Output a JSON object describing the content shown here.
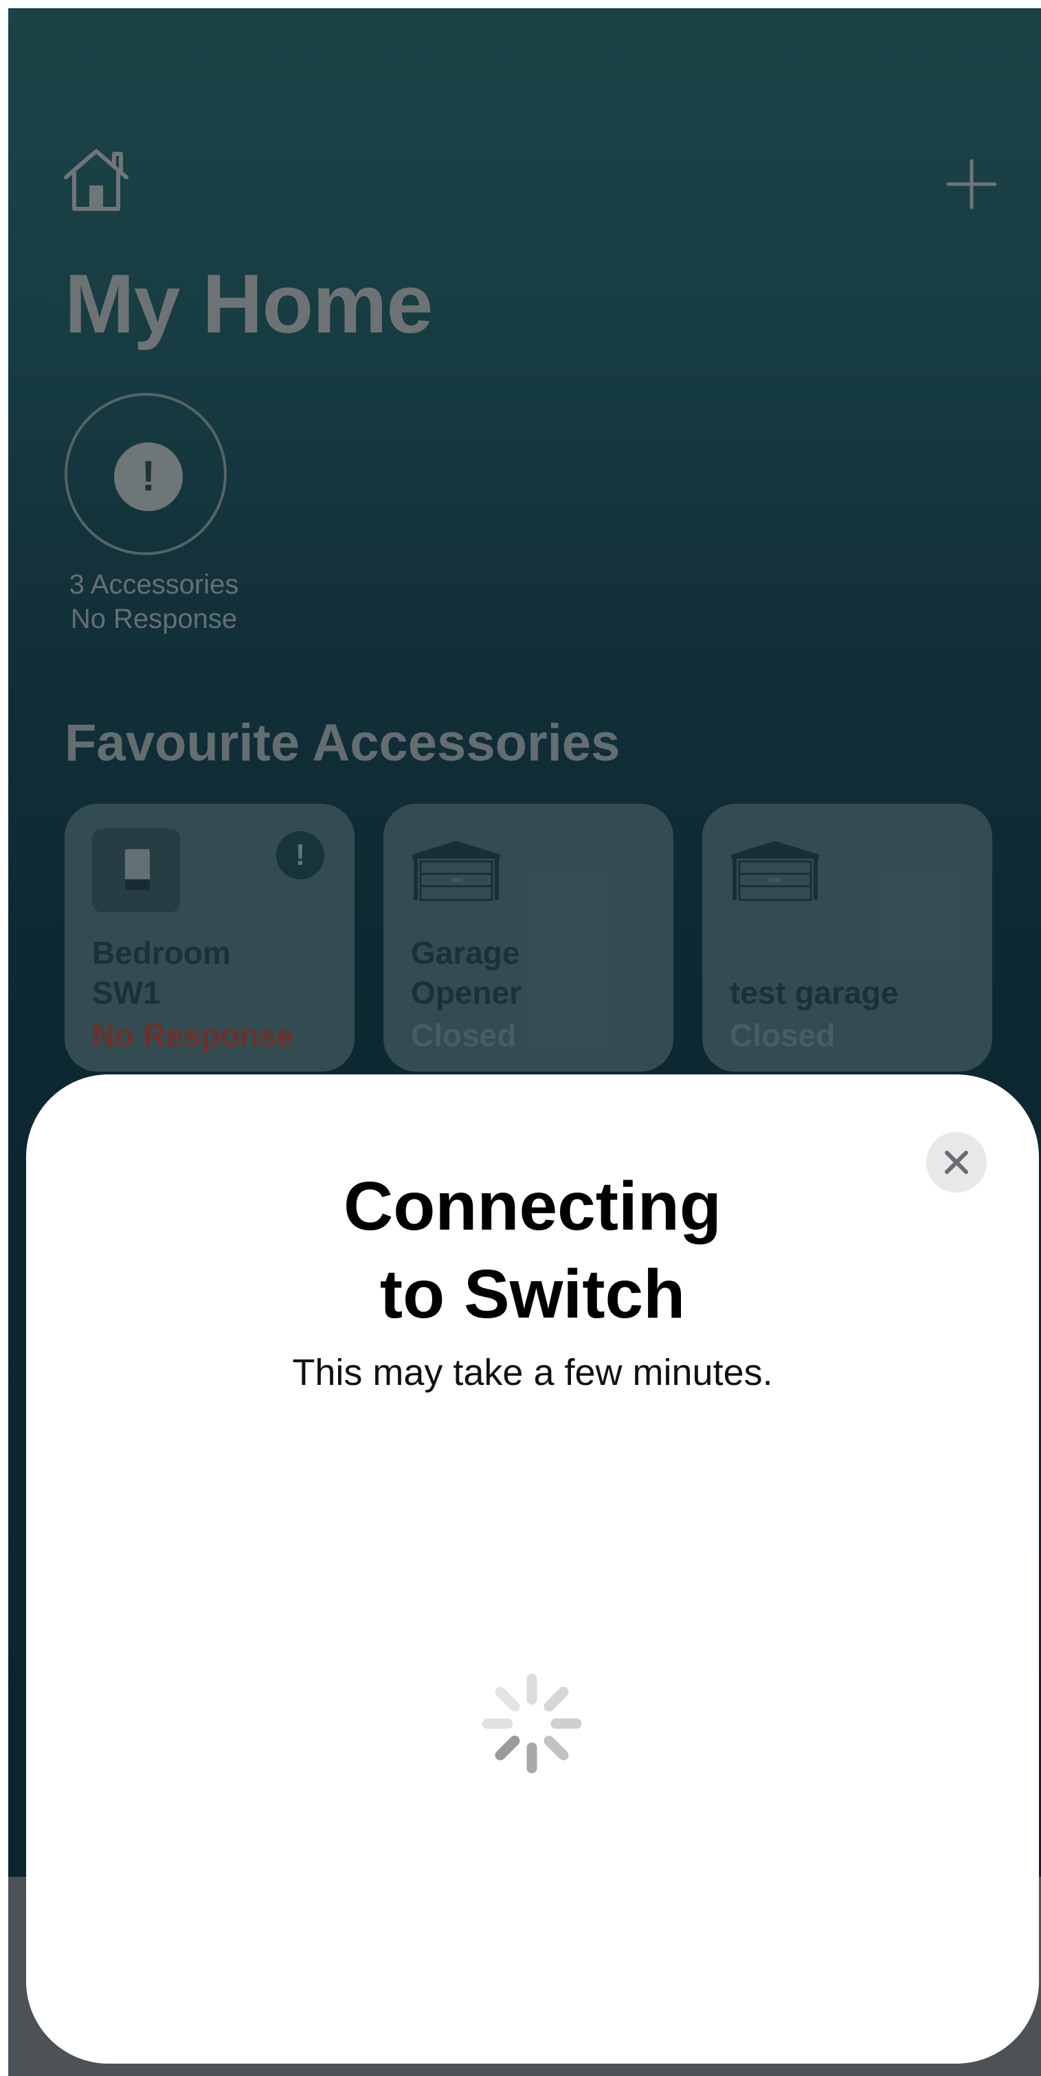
{
  "home": {
    "title": "My Home",
    "status": {
      "line1": "3 Accessories",
      "line2": "No Response"
    },
    "section_title": "Favourite Accessories",
    "tiles": [
      {
        "name": "Bedroom\nSW1",
        "state": "No Response",
        "icon": "light-switch-icon",
        "alert": "!"
      },
      {
        "name": "Garage\nOpener",
        "state": "Closed",
        "icon": "garage-door-icon"
      },
      {
        "name": "test garage",
        "state": "Closed",
        "icon": "garage-door-icon"
      }
    ],
    "alert_glyph": "!"
  },
  "sheet": {
    "title_line1": "Connecting",
    "title_line2": "to Switch",
    "subtitle": "This may take a few minutes."
  },
  "colors": {
    "background_top": "#235054",
    "background_bottom": "#0c2833",
    "sheet": "#ffffff",
    "no_response": "#8a3a33",
    "close_button": "#e8e8ea"
  },
  "icons": {
    "home": "home-icon",
    "add": "plus-icon",
    "close": "close-icon",
    "loading": "spinner-icon",
    "warning": "exclamation-icon"
  }
}
